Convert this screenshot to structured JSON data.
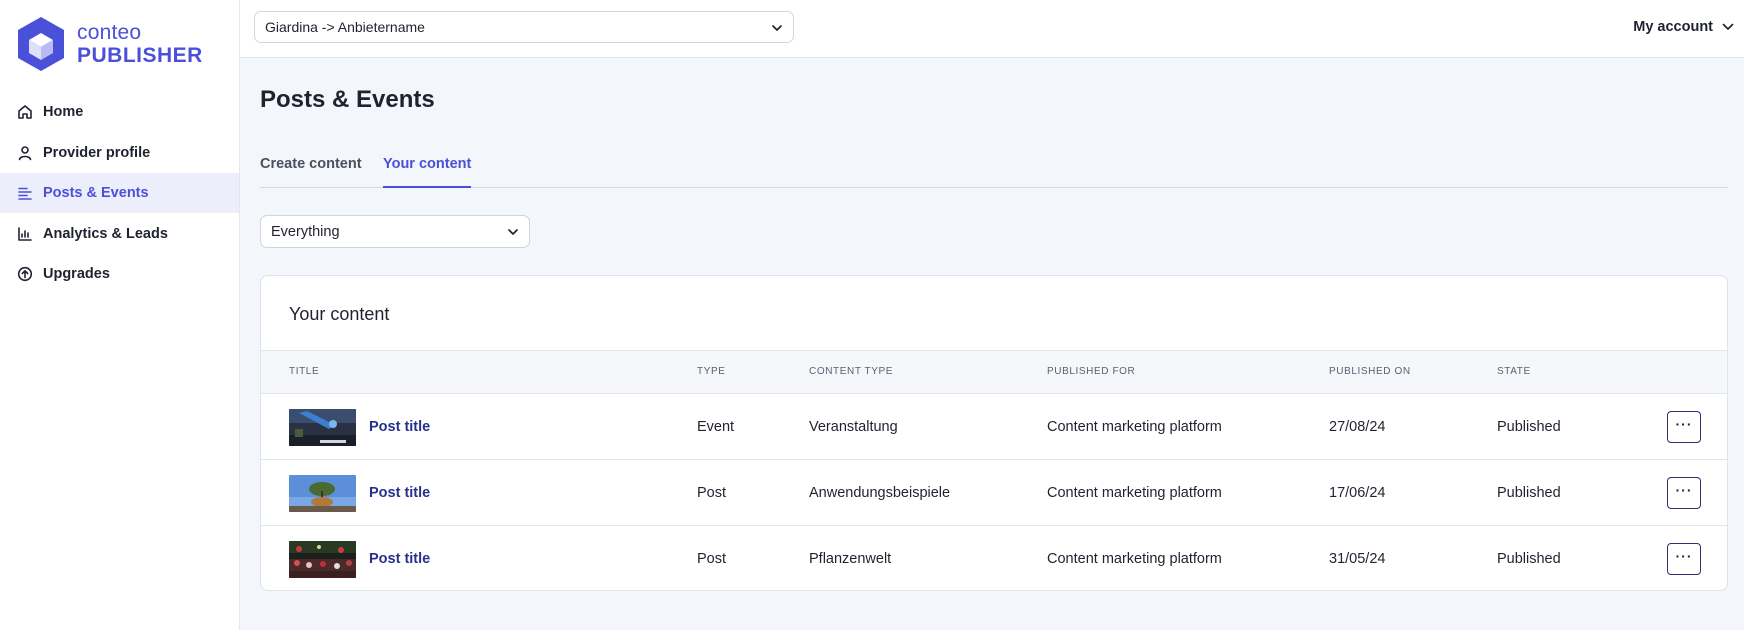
{
  "brand": {
    "line1": "conteo",
    "line2": "PUBLISHER",
    "accent": "#4b50d9"
  },
  "sidebar": {
    "items": [
      {
        "label": "Home",
        "icon": "home-icon",
        "active": false
      },
      {
        "label": "Provider profile",
        "icon": "user-icon",
        "active": false
      },
      {
        "label": "Posts & Events",
        "icon": "lines-icon",
        "active": true
      },
      {
        "label": "Analytics & Leads",
        "icon": "chart-icon",
        "active": false
      },
      {
        "label": "Upgrades",
        "icon": "arrow-up-circle-icon",
        "active": false
      }
    ]
  },
  "topbar": {
    "provider_select": "Giardina -> Anbietername",
    "account_label": "My account"
  },
  "main": {
    "title": "Posts & Events",
    "tabs": [
      {
        "label": "Create content",
        "active": false
      },
      {
        "label": "Your content",
        "active": true
      }
    ],
    "filter": "Everything",
    "card_title": "Your content",
    "columns": [
      "Title",
      "Type",
      "Content type",
      "Published for",
      "Published on",
      "State"
    ],
    "rows": [
      {
        "title": "Post title",
        "type": "Event",
        "content_type": "Veranstaltung",
        "published_for": "Content marketing platform",
        "published_on": "27/08/24",
        "state": "Published",
        "more": "···"
      },
      {
        "title": "Post title",
        "type": "Post",
        "content_type": "Anwendungsbeispiele",
        "published_for": "Content marketing platform",
        "published_on": "17/06/24",
        "state": "Published",
        "more": "···"
      },
      {
        "title": "Post title",
        "type": "Post",
        "content_type": "Pflanzenwelt",
        "published_for": "Content marketing platform",
        "published_on": "31/05/24",
        "state": "Published",
        "more": "···"
      }
    ]
  }
}
